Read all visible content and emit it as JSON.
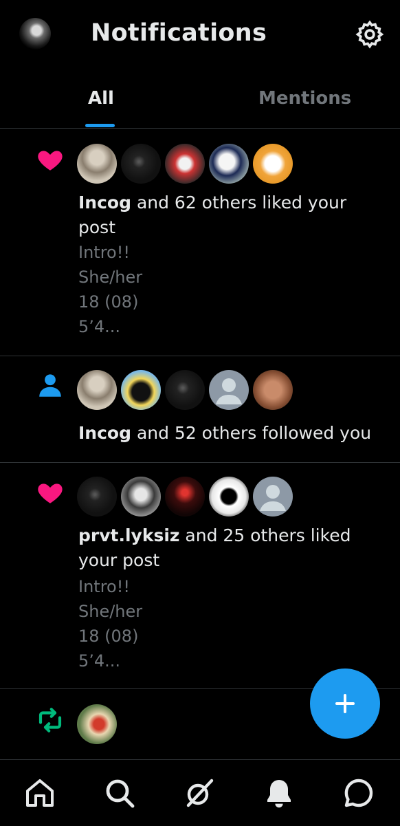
{
  "header": {
    "title": "Notifications",
    "avatar": "profile-avatar",
    "settings_icon": "gear-icon"
  },
  "tabs": [
    {
      "label": "All",
      "active": true
    },
    {
      "label": "Mentions",
      "active": false
    }
  ],
  "notifications": [
    {
      "type": "like",
      "icon": "heart-icon",
      "icon_color": "#f91880",
      "actor": "Incog",
      "rest": " and 62 others liked your post",
      "preview": [
        "Intro!!",
        "She/her",
        "18 (08)",
        "5’4..."
      ]
    },
    {
      "type": "follow",
      "icon": "person-icon",
      "icon_color": "#1d9bf0",
      "actor": "Incog",
      "rest": " and 52 others followed you",
      "preview": []
    },
    {
      "type": "like",
      "icon": "heart-icon",
      "icon_color": "#f91880",
      "actor": "prvt.lyksiz",
      "rest": " and 25 others liked your post",
      "preview": [
        "Intro!!",
        "She/her",
        "18 (08)",
        "5’4..."
      ]
    },
    {
      "type": "repost",
      "icon": "repost-icon",
      "icon_color": "#00ba7c",
      "actor": "",
      "rest": "",
      "preview": []
    }
  ],
  "fab": {
    "icon": "plus-icon",
    "color": "#1d9bf0"
  },
  "bottom_nav": [
    "home-icon",
    "search-icon",
    "grok-icon",
    "bell-icon",
    "messages-icon"
  ],
  "colors": {
    "background": "#000000",
    "text": "#e7e9ea",
    "muted": "#71767b",
    "accent": "#1d9bf0",
    "like": "#f91880",
    "repost": "#00ba7c"
  }
}
